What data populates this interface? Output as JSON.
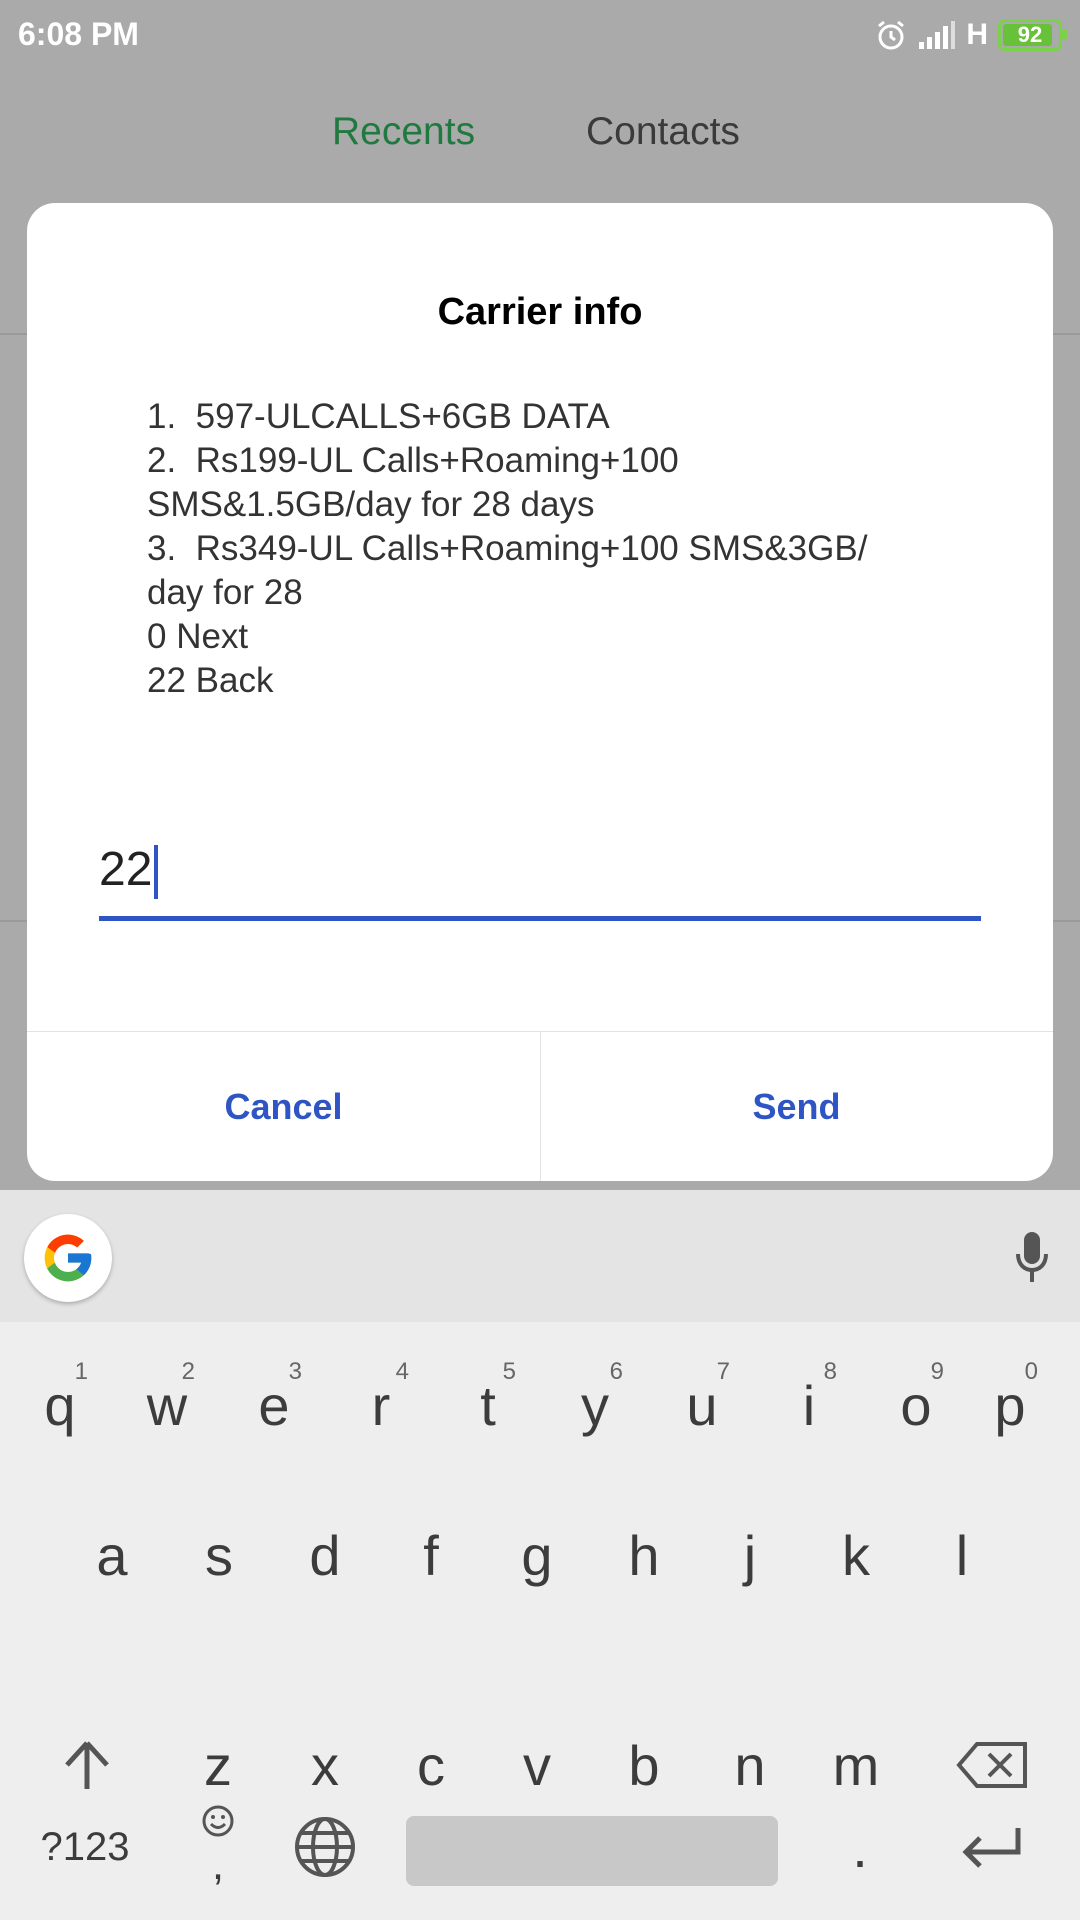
{
  "status_bar": {
    "time": "6:08 PM",
    "network": "H",
    "battery": "92",
    "battery_level_percent": 92,
    "icons": [
      "alarm-icon",
      "signal-icon",
      "battery-icon"
    ]
  },
  "tabs": {
    "recents": "Recents",
    "contacts": "Contacts",
    "active_color": "#1e7a3e"
  },
  "dialog": {
    "title": "Carrier info",
    "message_lines": [
      "1.  597-ULCALLS+6GB DATA",
      "2.  Rs199-UL Calls+Roaming+100",
      "SMS&1.5GB/day for 28 days",
      "3.  Rs349-UL Calls+Roaming+100 SMS&3GB/",
      "day for 28",
      "0 Next",
      "22 Back"
    ],
    "input_value": "22",
    "cancel_label": "Cancel",
    "send_label": "Send",
    "accent_color": "#2f55c4"
  },
  "keyboard": {
    "row1": [
      {
        "key": "q",
        "hint": "1"
      },
      {
        "key": "w",
        "hint": "2"
      },
      {
        "key": "e",
        "hint": "3"
      },
      {
        "key": "r",
        "hint": "4"
      },
      {
        "key": "t",
        "hint": "5"
      },
      {
        "key": "y",
        "hint": "6"
      },
      {
        "key": "u",
        "hint": "7"
      },
      {
        "key": "i",
        "hint": "8"
      },
      {
        "key": "o",
        "hint": "9"
      },
      {
        "key": "p",
        "hint": "0"
      }
    ],
    "row2": [
      "a",
      "s",
      "d",
      "f",
      "g",
      "h",
      "j",
      "k",
      "l"
    ],
    "row3": [
      "z",
      "x",
      "c",
      "v",
      "b",
      "n",
      "m"
    ],
    "symbols_label": "?123",
    "comma_label": ",",
    "period_label": ".",
    "icons": [
      "google-icon",
      "mic-icon",
      "shift-icon",
      "backspace-icon",
      "emoji-icon",
      "globe-icon",
      "enter-icon"
    ]
  }
}
